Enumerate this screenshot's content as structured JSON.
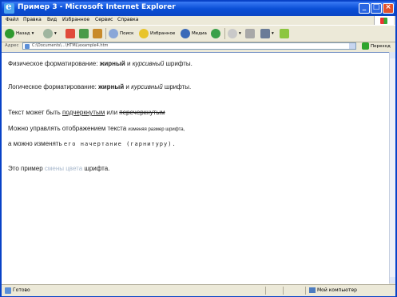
{
  "window": {
    "title": "Пример 3 - Microsoft Internet Explorer"
  },
  "menubar": {
    "items": [
      "Файл",
      "Правка",
      "Вид",
      "Избранное",
      "Сервис",
      "Справка"
    ]
  },
  "toolbar": {
    "back_label": "Назад",
    "search_label": "Поиск",
    "favorites_label": "Избранное",
    "media_label": "Медиа"
  },
  "address": {
    "label": "Адрес",
    "value": "C:\\Documents\\...\\HTML\\example4.htm",
    "go_label": "Переход"
  },
  "content": {
    "line1": {
      "prefix": "Физическое форматирование: ",
      "bold": "жирный",
      "middle": " и ",
      "italic": "курсивный",
      "suffix": " шрифты."
    },
    "line2": {
      "prefix": "Логическое форматирование: ",
      "bold": "жирный",
      "middle": " и ",
      "italic": "курсивный",
      "suffix": " шрифты."
    },
    "line3": {
      "prefix": "Текст может быть ",
      "underlined": "подчеркнутым",
      "middle": " или ",
      "strike": "перечеркнутым"
    },
    "line4": {
      "prefix": "Можно управлять отображением текста ",
      "small": "изменяя размер шрифта,"
    },
    "line5": {
      "prefix": "а можно изменять ",
      "mono": "его начертание (гарнитуру)."
    },
    "line6": {
      "prefix": "Это пример ",
      "colored": "смены цвета",
      "suffix": " шрифта."
    }
  },
  "status": {
    "text": "Готово",
    "zone": "Мой компьютер"
  }
}
